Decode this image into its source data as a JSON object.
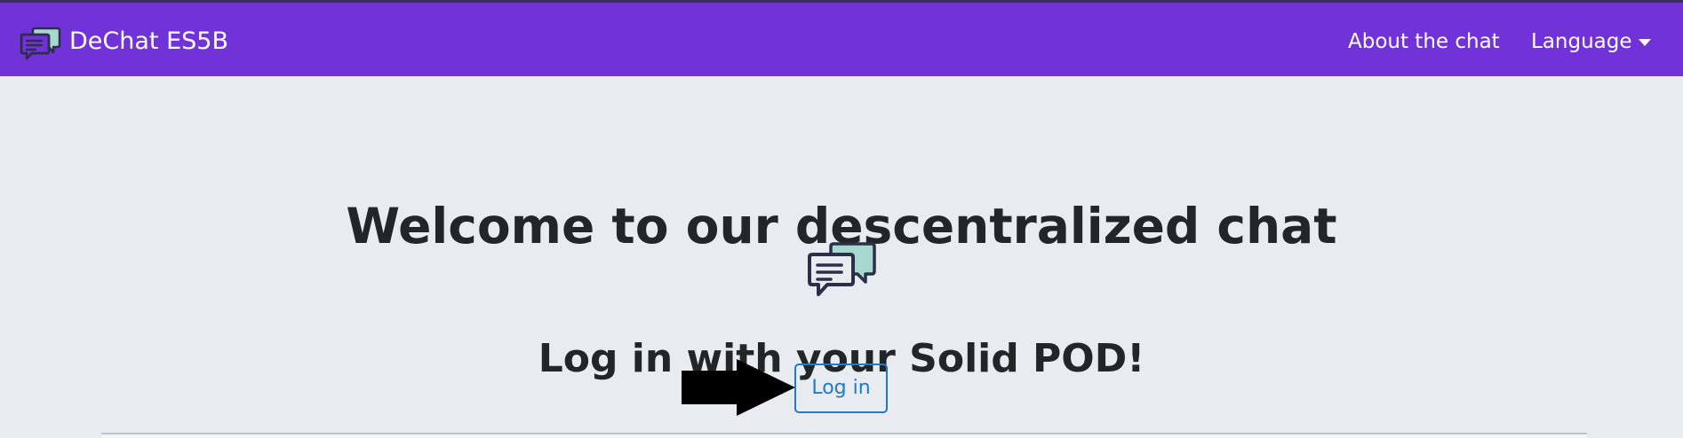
{
  "navbar": {
    "brand_title": "DeChat ES5B",
    "links": {
      "about": "About the chat",
      "language": "Language"
    },
    "background_color": "#7132d8"
  },
  "main": {
    "welcome_title": "Welcome to our descentralized chat",
    "login_prompt": "Log in with your Solid POD!",
    "login_button": "Log in",
    "hero_icon": "chat-bubbles-icon",
    "pointer_annotation": "arrow-right-icon"
  },
  "colors": {
    "page_background": "#e8ebef",
    "primary_text": "#222629",
    "button_blue": "#1f7ac9",
    "icon_mint": "#a7d8d0",
    "icon_dark": "#2d2f4a"
  }
}
